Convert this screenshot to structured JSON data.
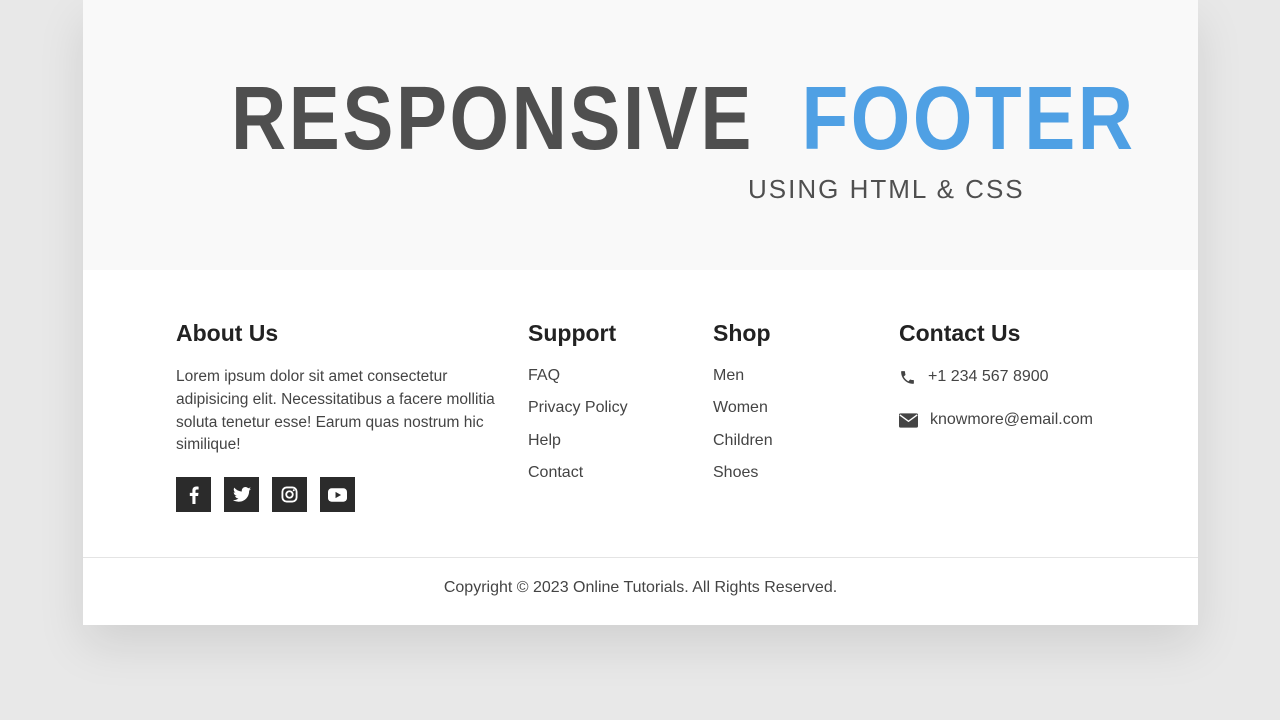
{
  "hero": {
    "title_part1": "RESPONSIVE",
    "title_part2": "FOOTER",
    "subtitle": "USING HTML & CSS",
    "accent_color": "#4fa0e4",
    "title_color": "#4f4f4f"
  },
  "footer": {
    "about": {
      "heading": "About Us",
      "text": "Lorem ipsum dolor sit amet consectetur adipisicing elit. Necessitatibus a facere mollitia soluta tenetur esse! Earum quas nostrum hic similique!",
      "social_icons": [
        "facebook-icon",
        "twitter-icon",
        "instagram-icon",
        "youtube-icon"
      ]
    },
    "support": {
      "heading": "Support",
      "links": [
        "FAQ",
        "Privacy Policy",
        "Help",
        "Contact"
      ]
    },
    "shop": {
      "heading": "Shop",
      "links": [
        "Men",
        "Women",
        "Children",
        "Shoes"
      ]
    },
    "contact": {
      "heading": "Contact Us",
      "phone": "+1 234 567 8900",
      "email": "knowmore@email.com"
    },
    "copyright": "Copyright © 2023 Online Tutorials. All Rights Reserved."
  }
}
